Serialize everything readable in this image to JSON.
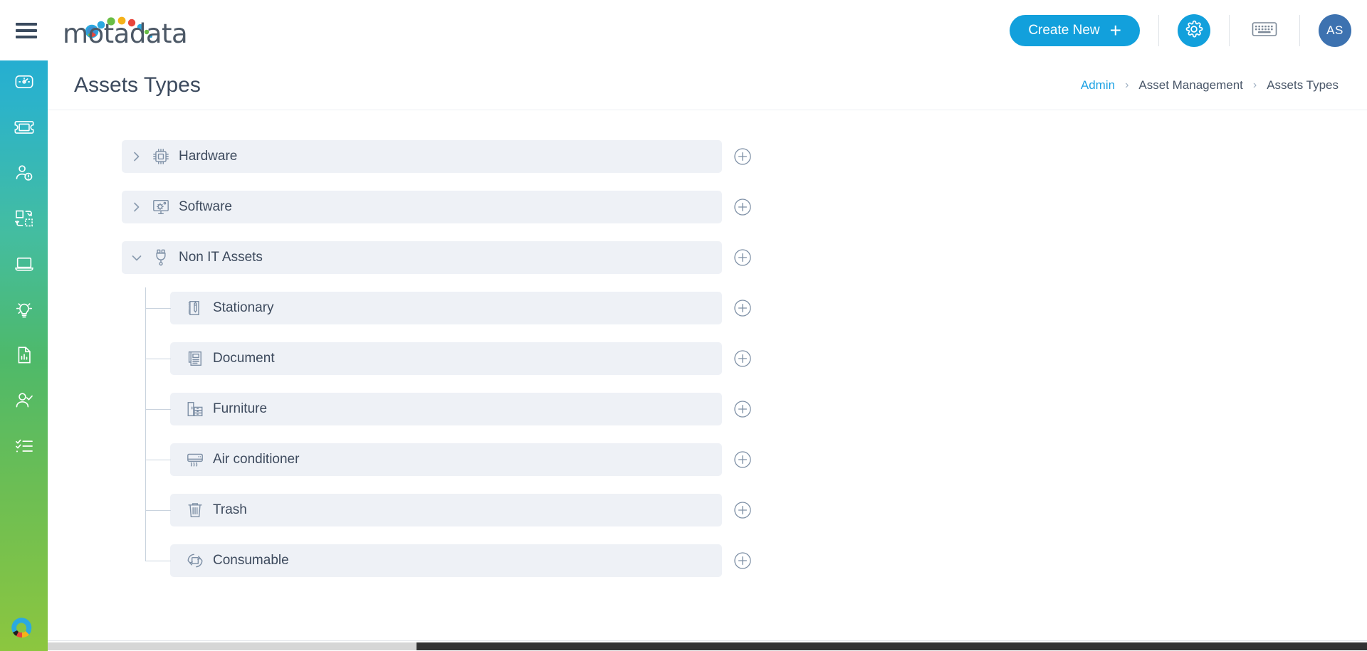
{
  "header": {
    "menu_icon": "hamburger-icon",
    "logo_text": "motadata",
    "logo_dot_colors": [
      "#3d8fd1",
      "#2ba9e0",
      "#69bd45",
      "#f5b21a",
      "#e8453c",
      "#2ba9e0",
      "#69bd45"
    ],
    "create_new_label": "Create New",
    "create_new_icon": "plus-icon",
    "settings_icon": "gear-icon",
    "keyboard_icon": "keyboard-icon",
    "avatar_initials": "AS",
    "accent_color": "#12a0dc",
    "avatar_color": "#3d72b0"
  },
  "sidebar": {
    "items": [
      {
        "name": "dashboard",
        "icon": "gauge-icon"
      },
      {
        "name": "tickets",
        "icon": "ticket-icon"
      },
      {
        "name": "users",
        "icon": "user-clock-icon"
      },
      {
        "name": "workflow",
        "icon": "transfer-boxes-icon"
      },
      {
        "name": "assets",
        "icon": "laptop-icon"
      },
      {
        "name": "knowledge",
        "icon": "lightbulb-icon"
      },
      {
        "name": "reports",
        "icon": "report-file-icon"
      },
      {
        "name": "approvals",
        "icon": "user-check-icon"
      },
      {
        "name": "tasks",
        "icon": "checklist-icon"
      }
    ],
    "footer_logo": "motadata-mark-icon",
    "gradient_from": "#1ca7dc",
    "gradient_to": "#8cc63f"
  },
  "page": {
    "title": "Assets Types",
    "breadcrumb": [
      {
        "label": "Admin",
        "is_link": true
      },
      {
        "label": "Asset Management",
        "is_link": false
      },
      {
        "label": "Assets Types",
        "is_link": false
      }
    ],
    "breadcrumb_separator": "›"
  },
  "tree": {
    "add_icon": "plus-circle-icon",
    "nodes": [
      {
        "label": "Hardware",
        "icon": "chip-icon",
        "expanded": false,
        "chevron": "chevron-right-icon",
        "children": []
      },
      {
        "label": "Software",
        "icon": "monitor-gear-icon",
        "expanded": false,
        "chevron": "chevron-right-icon",
        "children": []
      },
      {
        "label": "Non IT Assets",
        "icon": "plug-icon",
        "expanded": true,
        "chevron": "chevron-down-icon",
        "children": [
          {
            "label": "Stationary",
            "icon": "notebook-pen-icon"
          },
          {
            "label": "Document",
            "icon": "document-icon"
          },
          {
            "label": "Furniture",
            "icon": "furniture-icon"
          },
          {
            "label": "Air conditioner",
            "icon": "air-conditioner-icon"
          },
          {
            "label": "Trash",
            "icon": "trash-icon"
          },
          {
            "label": "Consumable",
            "icon": "recycle-box-icon"
          }
        ]
      }
    ]
  },
  "scrollbar": {
    "orientation": "horizontal",
    "thumb_color": "#333333"
  }
}
